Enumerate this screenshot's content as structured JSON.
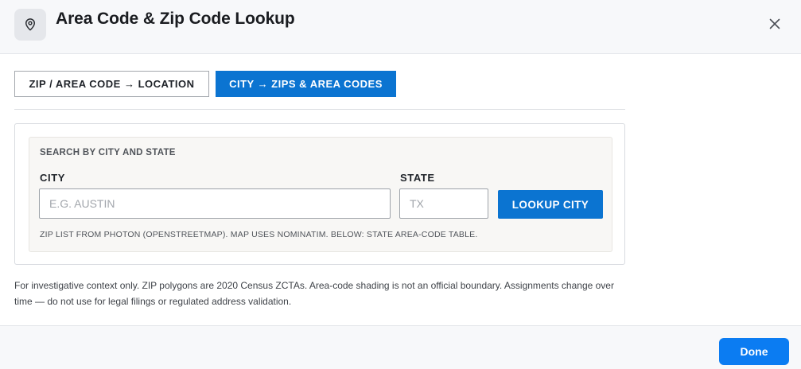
{
  "header": {
    "icon": "map-pin-icon",
    "title": "Area Code & Zip Code Lookup",
    "close_icon": "close-icon"
  },
  "tabs": [
    {
      "label": "ZIP / AREA CODE → LOCATION",
      "active": false
    },
    {
      "label": "CITY → ZIPS & AREA CODES",
      "active": true
    }
  ],
  "search": {
    "section_title": "SEARCH BY CITY AND STATE",
    "city_label": "CITY",
    "city_value": "",
    "city_placeholder": "E.G. AUSTIN",
    "state_label": "STATE",
    "state_value": "",
    "state_placeholder": "TX",
    "lookup_label": "LOOKUP CITY",
    "source_note": "ZIP LIST FROM PHOTON (OPENSTREETMAP). MAP USES NOMINATIM. BELOW: STATE AREA-CODE TABLE."
  },
  "disclaimer": "For investigative context only. ZIP polygons are 2020 Census ZCTAs. Area-code shading is not an official boundary. Assignments change over time — do not use for legal filings or regulated address validation.",
  "footer": {
    "done_label": "Done"
  },
  "colors": {
    "accent": "#0b74d1",
    "done": "#0b7cf2",
    "header_bg": "#f7f8fa",
    "search_bg": "#f8f7f5"
  }
}
